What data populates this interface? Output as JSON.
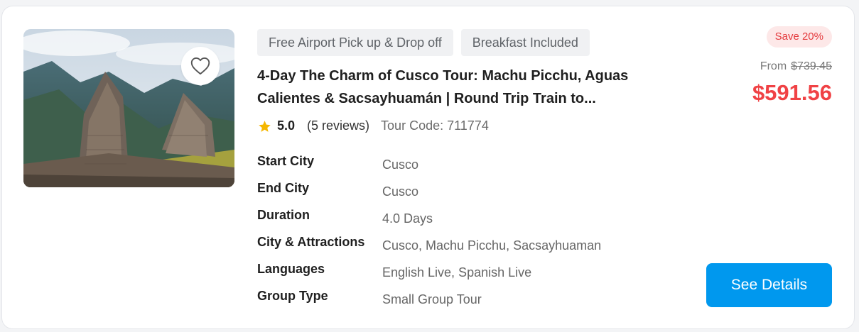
{
  "tags": [
    "Free Airport Pick up & Drop off",
    "Breakfast Included"
  ],
  "title": "4-Day The Charm of Cusco Tour: Machu Picchu, Aguas Calientes & Sacsayhuamán | Round Trip Train to...",
  "rating": {
    "score": "5.0",
    "reviews": "(5 reviews)",
    "tour_code": "Tour Code: 711774"
  },
  "details": [
    {
      "label": "Start City",
      "value": "Cusco"
    },
    {
      "label": "End City",
      "value": "Cusco"
    },
    {
      "label": "Duration",
      "value": "4.0 Days"
    },
    {
      "label": "City & Attractions",
      "value": "Cusco, Machu Picchu, Sacsayhuaman"
    },
    {
      "label": "Languages",
      "value": "English Live, Spanish Live"
    },
    {
      "label": "Group Type",
      "value": "Small Group Tour"
    }
  ],
  "pricing": {
    "save_badge": "Save 20%",
    "from_label": "From",
    "original_price": "$739.45",
    "price": "$591.56"
  },
  "cta": {
    "label": "See Details"
  },
  "icons": {
    "favorite": "heart-outline-icon",
    "rating": "star-icon"
  },
  "colors": {
    "price": "#f04245",
    "button": "#0098ee",
    "save_badge_bg": "#fde8e8",
    "star": "#f5b700"
  }
}
